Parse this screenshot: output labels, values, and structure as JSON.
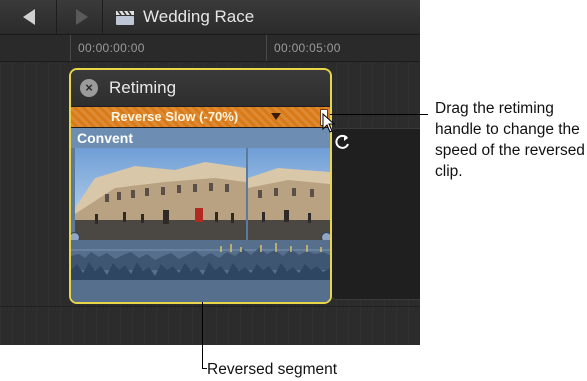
{
  "titlebar": {
    "project_name": "Wedding Race",
    "back_icon": "back-arrow-icon",
    "forward_icon": "forward-arrow-icon",
    "project_icon": "clapperboard-icon"
  },
  "ruler": {
    "timecodes": [
      "00:00:00:00",
      "00:00:05:00"
    ]
  },
  "retiming": {
    "title": "Retiming",
    "speed_label": "Reverse Slow (-70%)",
    "speed_color": "#d97a18",
    "border_color": "#e8d54a"
  },
  "clip": {
    "name": "Convent",
    "color": "#6d8db3"
  },
  "callouts": {
    "handle_note": "Drag the retiming handle to change the speed of the reversed clip.",
    "segment_note": "Reversed segment"
  }
}
